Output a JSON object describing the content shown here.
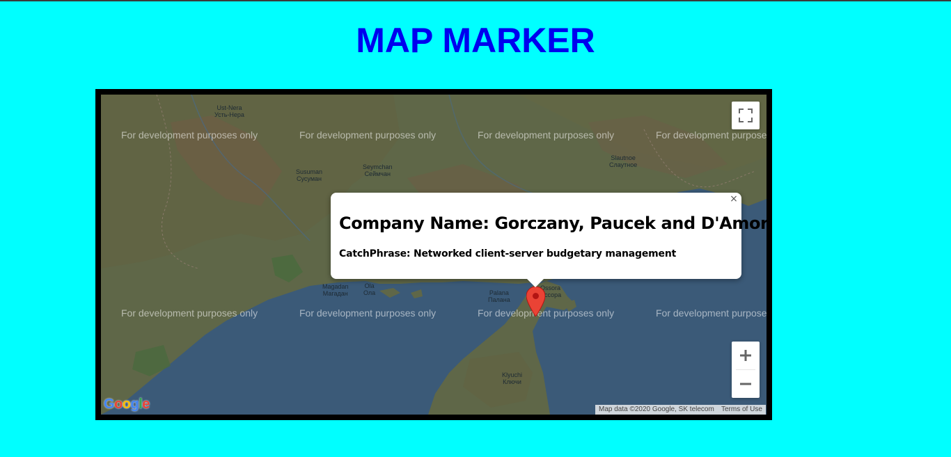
{
  "page": {
    "title": "MAP MARKER",
    "background_color": "#00ffff",
    "title_color": "#0000ee"
  },
  "map": {
    "watermark_text": "For development purposes only",
    "places": {
      "ust_nera": [
        "Ust-Nera",
        "Усть-Нера"
      ],
      "susuman": [
        "Susuman",
        "Сусуман"
      ],
      "seymchan": [
        "Seymchan",
        "Сеймчан"
      ],
      "slautnoe": [
        "Slautnoe",
        "Слаутное"
      ],
      "magadan": [
        "Magadan",
        "Магадан"
      ],
      "ola": [
        "Ola",
        "Ола"
      ],
      "palana": [
        "Palana",
        "Палана"
      ],
      "ossora": [
        "Ossora",
        "Оссора"
      ],
      "klyuchi": [
        "Klyuchi",
        "Ключи"
      ]
    },
    "info_window": {
      "title": "Company Name: Gorczany, Paucek and D'Amore",
      "subtitle": "CatchPhrase: Networked client-server budgetary management",
      "close_icon": "×"
    },
    "controls": {
      "fullscreen_icon": "fullscreen-icon",
      "zoom_in_icon": "plus-icon",
      "zoom_out_icon": "minus-icon"
    },
    "logo": {
      "letters": [
        "G",
        "o",
        "o",
        "g",
        "l",
        "e"
      ],
      "colors": [
        "#4285f4",
        "#ea4335",
        "#fbbc05",
        "#4285f4",
        "#34a853",
        "#ea4335"
      ]
    },
    "attribution": {
      "map_data": "Map data ©2020 Google, SK telecom",
      "terms": "Terms of Use"
    },
    "marker_color": "#ea4335"
  }
}
